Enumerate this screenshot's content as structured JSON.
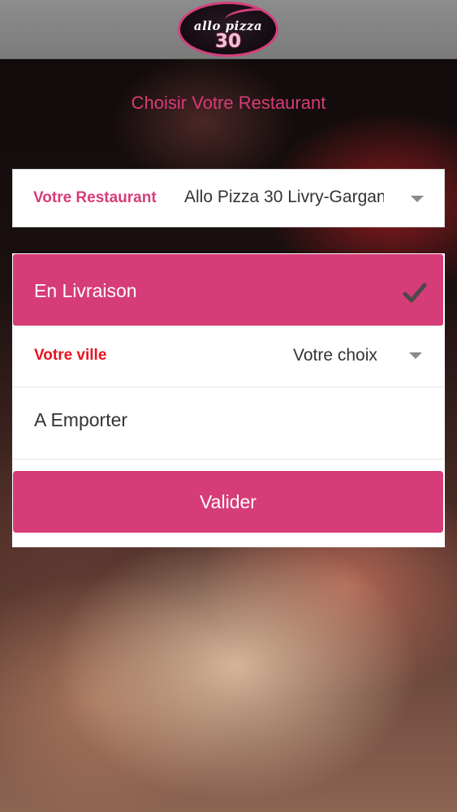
{
  "header": {
    "logo_text": "allo pizza",
    "logo_number": "30"
  },
  "heading": "Choisir Votre Restaurant",
  "restaurant_select": {
    "label": "Votre Restaurant",
    "value": "Allo Pizza 30 Livry-Gargan"
  },
  "options": {
    "livraison_label": "En Livraison",
    "livraison_selected": true,
    "ville_label": "Votre ville",
    "ville_value": "Votre choix",
    "emporter_label": "A Emporter"
  },
  "submit_label": "Valider",
  "colors": {
    "accent": "#d63c78",
    "ville_label": "#e8131f",
    "topbar": "#858585"
  },
  "icons": {
    "selected_option": "checkmark-icon",
    "dropdowns": "caret-down-icon"
  }
}
